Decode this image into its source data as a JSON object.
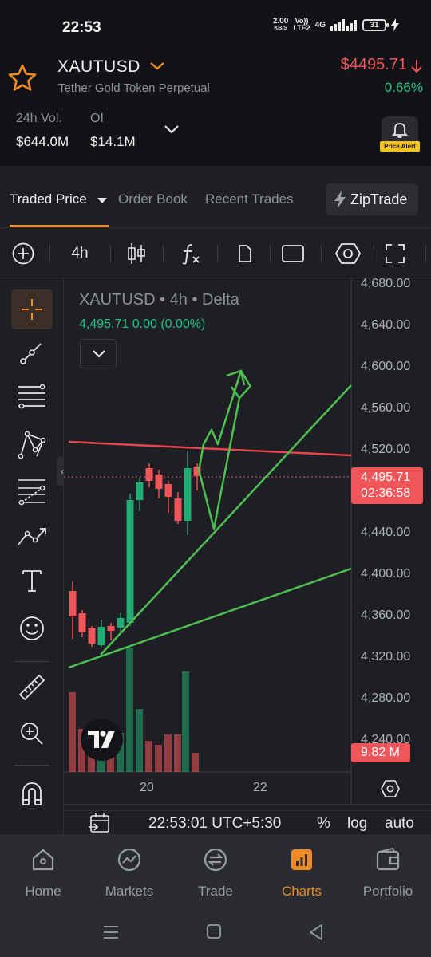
{
  "status": {
    "time": "22:53",
    "net_speed_value": "2.00",
    "net_speed_unit": "KB/S",
    "volte_top": "Vo))",
    "volte_bottom": "LTE2",
    "network": "4G",
    "battery": "31"
  },
  "header": {
    "symbol": "XAUTUSD",
    "subtitle": "Tether Gold Token Perpetual",
    "price": "$4495.71",
    "change": "0.66%",
    "vol_label": "24h Vol.",
    "vol_value": "$644.0M",
    "oi_label": "OI",
    "oi_value": "$14.1M",
    "price_alert_label": "Price Alert"
  },
  "tabs": [
    {
      "label": "Traded Price",
      "active": true
    },
    {
      "label": "Order Book",
      "active": false
    },
    {
      "label": "Recent Trades",
      "active": false
    }
  ],
  "ziptrade_label": "ZipTrade",
  "toolbar": {
    "interval": "4h"
  },
  "chart": {
    "legend_title": "XAUTUSD • 4h • Delta",
    "legend_values": "4,495.71  0.00 (0.00%)",
    "y_ticks": [
      "4,680.00",
      "4,640.00",
      "4,600.00",
      "4,560.00",
      "4,520.00",
      "4,440.00",
      "4,400.00",
      "4,360.00",
      "4,320.00",
      "4,280.00",
      "4,240.00"
    ],
    "price_tag_value": "4,495.71",
    "price_tag_countdown": "02:36:58",
    "volume_tag": "9.82 M",
    "x_ticks": [
      "20",
      "22"
    ],
    "up_color": "#22ab72",
    "down_color": "#f0555a"
  },
  "chart_bar": {
    "clock": "22:53:01 UTC+5:30",
    "percent": "%",
    "log": "log",
    "auto": "auto"
  },
  "nav": [
    {
      "label": "Home",
      "icon": "home-icon",
      "active": false
    },
    {
      "label": "Markets",
      "icon": "markets-icon",
      "active": false
    },
    {
      "label": "Trade",
      "icon": "trade-icon",
      "active": false
    },
    {
      "label": "Charts",
      "icon": "charts-icon",
      "active": true
    },
    {
      "label": "Portfolio",
      "icon": "portfolio-icon",
      "active": false
    }
  ],
  "accent_color": "#f08a24"
}
